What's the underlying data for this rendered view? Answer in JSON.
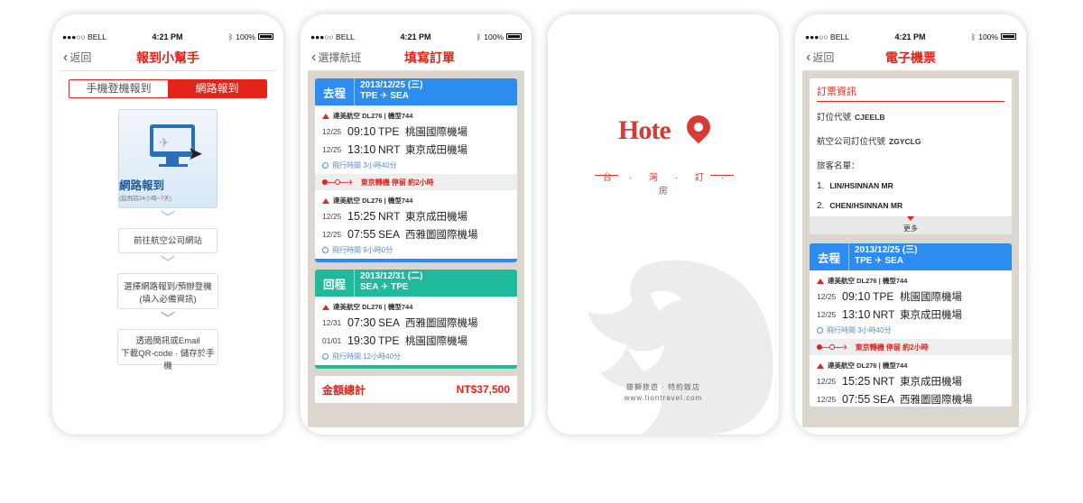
{
  "status": {
    "carrier": "●●●○○ BELL",
    "time": "4:21 PM",
    "battery": "100%"
  },
  "s1": {
    "back": "返回",
    "title": "報到小幫手",
    "seg_off": "手機登機報到",
    "seg_on": "網路報到",
    "big_title": "網路報到",
    "big_sub": "(起飛前24小時~7天)",
    "step1": "前往航空公司網站",
    "step2a": "選擇網路報到/預辦登機",
    "step2b": "(填入必備資訊)",
    "step3a": "透過簡訊或Email",
    "step3b": "下載QR-code · 儲存於手機"
  },
  "s2": {
    "back": "選擇航班",
    "title": "填寫訂單",
    "out": {
      "dir": "去程",
      "date": "2013/12/25 (三)",
      "route": "TPE ✈ SEA",
      "airline1": "達美航空 DL276 | 機型744",
      "r1": {
        "d": "12/25",
        "t": "09:10",
        "a": "TPE",
        "n": "桃園國際機場"
      },
      "r2": {
        "d": "12/25",
        "t": "13:10",
        "a": "NRT",
        "n": "東京成田機場"
      },
      "dur1": "飛行時間 3小時40分",
      "transfer": "東京轉機 停留 約2小時",
      "airline2": "達美航空 DL276 | 機型744",
      "r3": {
        "d": "12/25",
        "t": "15:25",
        "a": "NRT",
        "n": "東京成田機場"
      },
      "r4": {
        "d": "12/25",
        "t": "07:55",
        "a": "SEA",
        "n": "西雅圖國際機場"
      },
      "dur2": "飛行時間 9小時0分"
    },
    "ret": {
      "dir": "回程",
      "date": "2013/12/31 (二)",
      "route": "SEA ✈ TPE",
      "airline": "達美航空 DL276 | 機型744",
      "r1": {
        "d": "12/31",
        "t": "07:30",
        "a": "SEA",
        "n": "西雅圖國際機場"
      },
      "r2": {
        "d": "01/01",
        "t": "19:30",
        "a": "TPE",
        "n": "桃園國際機場"
      },
      "dur": "飛行時間 12小時40分"
    },
    "total_label": "金額總計",
    "total_value": "NT$37,500"
  },
  "s3": {
    "logo": "Hote",
    "tag": "台 · 灣 · 訂 · 房",
    "foot1": "雄獅旅遊 · 特約飯店",
    "foot2": "www.liontravel.com"
  },
  "s4": {
    "back": "返回",
    "title": "電子機票",
    "sec": "訂票資訊",
    "code_label": "訂位代號",
    "code": "CJEELB",
    "acode_label": "航空公司訂位代號",
    "acode": "ZGYCLG",
    "pax_label": "旅客名單：",
    "pax": [
      "LIN/HSINNAN  MR",
      "CHEN/HSINNAN  MR"
    ],
    "more": "更多",
    "out": {
      "dir": "去程",
      "date": "2013/12/25 (三)",
      "route": "TPE ✈ SEA",
      "airline1": "達美航空 DL276 | 機型744",
      "r1": {
        "d": "12/25",
        "t": "09:10",
        "a": "TPE",
        "n": "桃園國際機場"
      },
      "r2": {
        "d": "12/25",
        "t": "13:10",
        "a": "NRT",
        "n": "東京成田機場"
      },
      "dur1": "飛行時間 3小時40分",
      "transfer": "東京轉機 停留 約2小時",
      "airline2": "達美航空 DL276 | 機型744",
      "r3": {
        "d": "12/25",
        "t": "15:25",
        "a": "NRT",
        "n": "東京成田機場"
      },
      "r4": {
        "d": "12/25",
        "t": "07:55",
        "a": "SEA",
        "n": "西雅圖國際機場"
      }
    }
  }
}
